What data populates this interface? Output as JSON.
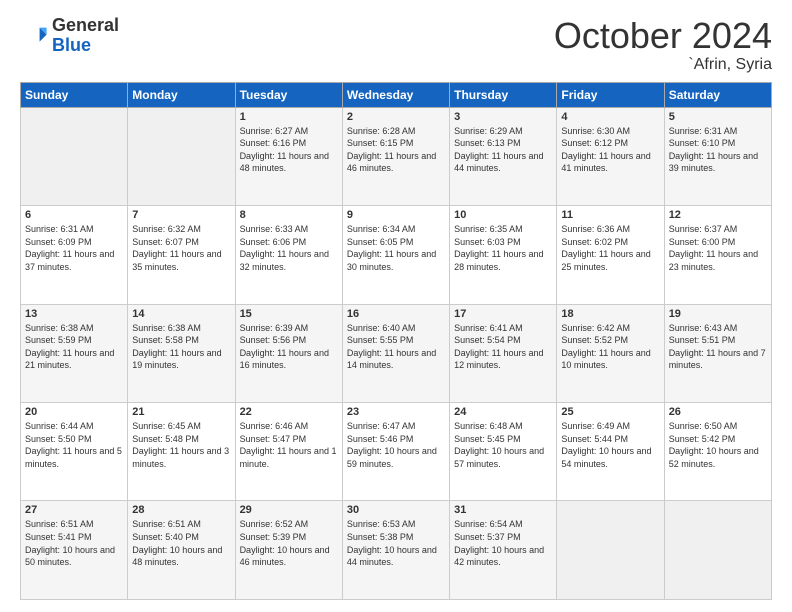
{
  "header": {
    "logo_general": "General",
    "logo_blue": "Blue",
    "month": "October 2024",
    "location": "`Afrin, Syria"
  },
  "weekdays": [
    "Sunday",
    "Monday",
    "Tuesday",
    "Wednesday",
    "Thursday",
    "Friday",
    "Saturday"
  ],
  "weeks": [
    [
      {
        "day": "",
        "info": ""
      },
      {
        "day": "",
        "info": ""
      },
      {
        "day": "1",
        "info": "Sunrise: 6:27 AM\nSunset: 6:16 PM\nDaylight: 11 hours and 48 minutes."
      },
      {
        "day": "2",
        "info": "Sunrise: 6:28 AM\nSunset: 6:15 PM\nDaylight: 11 hours and 46 minutes."
      },
      {
        "day": "3",
        "info": "Sunrise: 6:29 AM\nSunset: 6:13 PM\nDaylight: 11 hours and 44 minutes."
      },
      {
        "day": "4",
        "info": "Sunrise: 6:30 AM\nSunset: 6:12 PM\nDaylight: 11 hours and 41 minutes."
      },
      {
        "day": "5",
        "info": "Sunrise: 6:31 AM\nSunset: 6:10 PM\nDaylight: 11 hours and 39 minutes."
      }
    ],
    [
      {
        "day": "6",
        "info": "Sunrise: 6:31 AM\nSunset: 6:09 PM\nDaylight: 11 hours and 37 minutes."
      },
      {
        "day": "7",
        "info": "Sunrise: 6:32 AM\nSunset: 6:07 PM\nDaylight: 11 hours and 35 minutes."
      },
      {
        "day": "8",
        "info": "Sunrise: 6:33 AM\nSunset: 6:06 PM\nDaylight: 11 hours and 32 minutes."
      },
      {
        "day": "9",
        "info": "Sunrise: 6:34 AM\nSunset: 6:05 PM\nDaylight: 11 hours and 30 minutes."
      },
      {
        "day": "10",
        "info": "Sunrise: 6:35 AM\nSunset: 6:03 PM\nDaylight: 11 hours and 28 minutes."
      },
      {
        "day": "11",
        "info": "Sunrise: 6:36 AM\nSunset: 6:02 PM\nDaylight: 11 hours and 25 minutes."
      },
      {
        "day": "12",
        "info": "Sunrise: 6:37 AM\nSunset: 6:00 PM\nDaylight: 11 hours and 23 minutes."
      }
    ],
    [
      {
        "day": "13",
        "info": "Sunrise: 6:38 AM\nSunset: 5:59 PM\nDaylight: 11 hours and 21 minutes."
      },
      {
        "day": "14",
        "info": "Sunrise: 6:38 AM\nSunset: 5:58 PM\nDaylight: 11 hours and 19 minutes."
      },
      {
        "day": "15",
        "info": "Sunrise: 6:39 AM\nSunset: 5:56 PM\nDaylight: 11 hours and 16 minutes."
      },
      {
        "day": "16",
        "info": "Sunrise: 6:40 AM\nSunset: 5:55 PM\nDaylight: 11 hours and 14 minutes."
      },
      {
        "day": "17",
        "info": "Sunrise: 6:41 AM\nSunset: 5:54 PM\nDaylight: 11 hours and 12 minutes."
      },
      {
        "day": "18",
        "info": "Sunrise: 6:42 AM\nSunset: 5:52 PM\nDaylight: 11 hours and 10 minutes."
      },
      {
        "day": "19",
        "info": "Sunrise: 6:43 AM\nSunset: 5:51 PM\nDaylight: 11 hours and 7 minutes."
      }
    ],
    [
      {
        "day": "20",
        "info": "Sunrise: 6:44 AM\nSunset: 5:50 PM\nDaylight: 11 hours and 5 minutes."
      },
      {
        "day": "21",
        "info": "Sunrise: 6:45 AM\nSunset: 5:48 PM\nDaylight: 11 hours and 3 minutes."
      },
      {
        "day": "22",
        "info": "Sunrise: 6:46 AM\nSunset: 5:47 PM\nDaylight: 11 hours and 1 minute."
      },
      {
        "day": "23",
        "info": "Sunrise: 6:47 AM\nSunset: 5:46 PM\nDaylight: 10 hours and 59 minutes."
      },
      {
        "day": "24",
        "info": "Sunrise: 6:48 AM\nSunset: 5:45 PM\nDaylight: 10 hours and 57 minutes."
      },
      {
        "day": "25",
        "info": "Sunrise: 6:49 AM\nSunset: 5:44 PM\nDaylight: 10 hours and 54 minutes."
      },
      {
        "day": "26",
        "info": "Sunrise: 6:50 AM\nSunset: 5:42 PM\nDaylight: 10 hours and 52 minutes."
      }
    ],
    [
      {
        "day": "27",
        "info": "Sunrise: 6:51 AM\nSunset: 5:41 PM\nDaylight: 10 hours and 50 minutes."
      },
      {
        "day": "28",
        "info": "Sunrise: 6:51 AM\nSunset: 5:40 PM\nDaylight: 10 hours and 48 minutes."
      },
      {
        "day": "29",
        "info": "Sunrise: 6:52 AM\nSunset: 5:39 PM\nDaylight: 10 hours and 46 minutes."
      },
      {
        "day": "30",
        "info": "Sunrise: 6:53 AM\nSunset: 5:38 PM\nDaylight: 10 hours and 44 minutes."
      },
      {
        "day": "31",
        "info": "Sunrise: 6:54 AM\nSunset: 5:37 PM\nDaylight: 10 hours and 42 minutes."
      },
      {
        "day": "",
        "info": ""
      },
      {
        "day": "",
        "info": ""
      }
    ]
  ]
}
